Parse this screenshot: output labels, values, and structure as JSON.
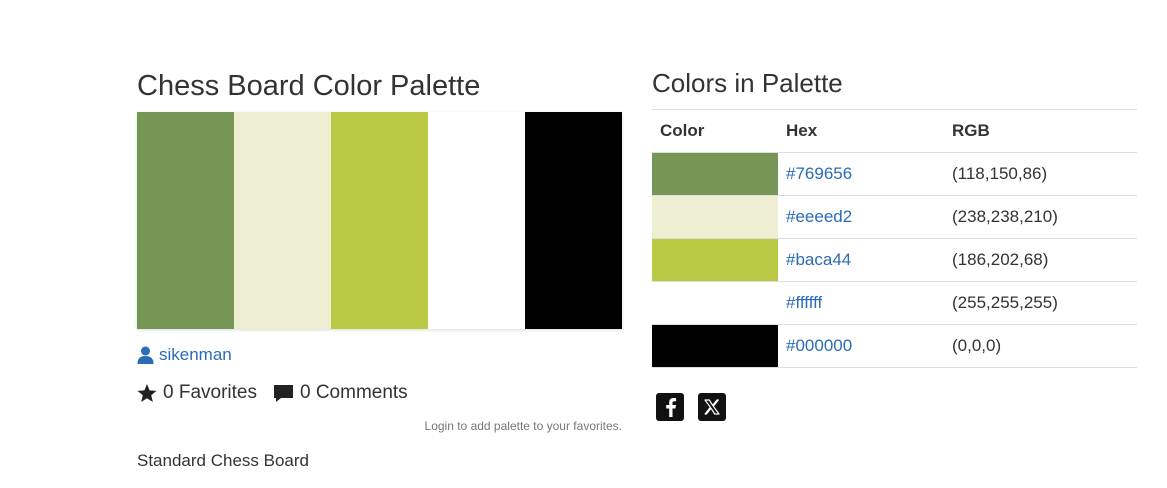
{
  "palette": {
    "title": "Chess Board Color Palette",
    "swatches": [
      "#769656",
      "#eeeed2",
      "#baca44",
      "#ffffff",
      "#000000"
    ],
    "author": "sikenman",
    "favorites_label": "0 Favorites",
    "comments_label": "0 Comments",
    "login_note": "Login to add palette to your favorites.",
    "description": "Standard Chess Board"
  },
  "colors_section": {
    "title": "Colors in Palette",
    "headers": {
      "color": "Color",
      "hex": "Hex",
      "rgb": "RGB"
    },
    "rows": [
      {
        "swatch": "#769656",
        "hex": "#769656",
        "rgb": "(118,150,86)"
      },
      {
        "swatch": "#eeeed2",
        "hex": "#eeeed2",
        "rgb": "(238,238,210)"
      },
      {
        "swatch": "#baca44",
        "hex": "#baca44",
        "rgb": "(186,202,68)"
      },
      {
        "swatch": "#ffffff",
        "hex": "#ffffff",
        "rgb": "(255,255,255)"
      },
      {
        "swatch": "#000000",
        "hex": "#000000",
        "rgb": "(0,0,0)"
      }
    ]
  },
  "share": {
    "icons": [
      "facebook-icon",
      "x-icon"
    ]
  },
  "theme": {
    "link_color": "#2a6cb5",
    "text_color": "#333333",
    "border_color": "#dddddd"
  }
}
